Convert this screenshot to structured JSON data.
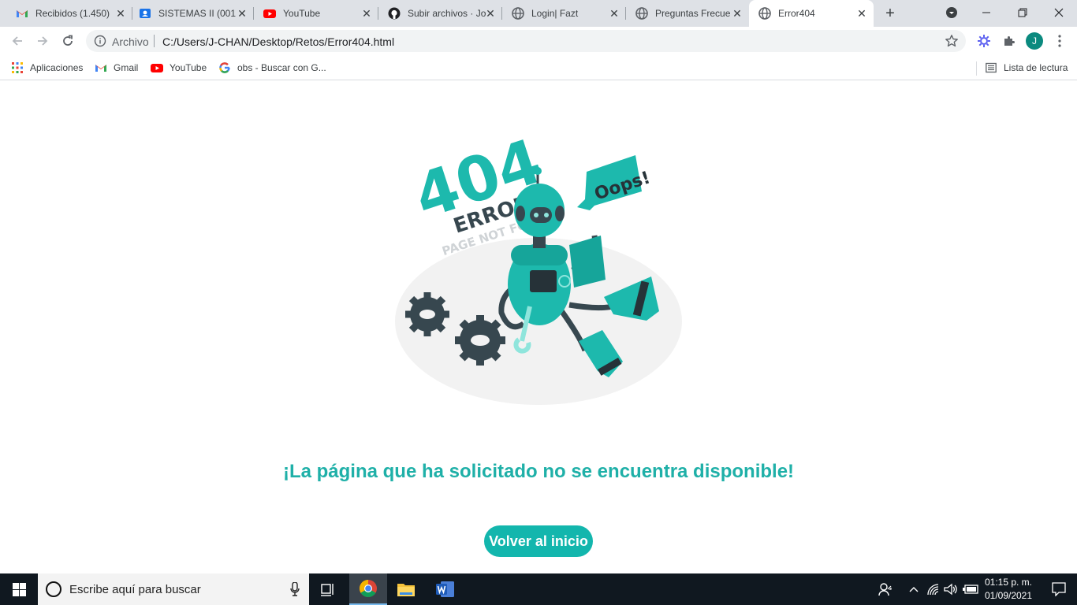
{
  "browser": {
    "tabs": [
      {
        "title": "Recibidos (1.450)",
        "icon": "gmail-icon"
      },
      {
        "title": "SISTEMAS II (001",
        "icon": "classroom-icon"
      },
      {
        "title": "YouTube",
        "icon": "youtube-icon"
      },
      {
        "title": "Subir archivos · Jo",
        "icon": "github-icon"
      },
      {
        "title": "Login| Fazt",
        "icon": "globe-icon"
      },
      {
        "title": "Preguntas Frecue",
        "icon": "globe-icon"
      },
      {
        "title": "Error404",
        "icon": "globe-icon",
        "active": true
      }
    ],
    "address": {
      "chip": "Archivo",
      "url": "C:/Users/J-CHAN/Desktop/Retos/Error404.html"
    },
    "profile_initial": "J",
    "bookmarks": [
      {
        "label": "Aplicaciones",
        "icon": "apps-grid-icon"
      },
      {
        "label": "Gmail",
        "icon": "gmail-icon"
      },
      {
        "label": "YouTube",
        "icon": "youtube-icon"
      },
      {
        "label": "obs - Buscar con G...",
        "icon": "google-icon"
      }
    ],
    "reading_list": "Lista de lectura"
  },
  "page": {
    "illustration": {
      "big_text": "404",
      "sub_text": "ERROR",
      "caption": "PAGE NOT FOUND",
      "bubble": "Oops!"
    },
    "message": "¡La página que ha solicitado no se encuentra disponible!",
    "button_label": "Volver al inicio"
  },
  "taskbar": {
    "search_placeholder": "Escribe aquí para buscar",
    "time": "01:15 p. m.",
    "date": "01/09/2021"
  },
  "colors": {
    "accent": "#1fb0a8",
    "button": "#13b6ad",
    "robot": "#2ec4b6",
    "dark": "#2f3e46"
  }
}
